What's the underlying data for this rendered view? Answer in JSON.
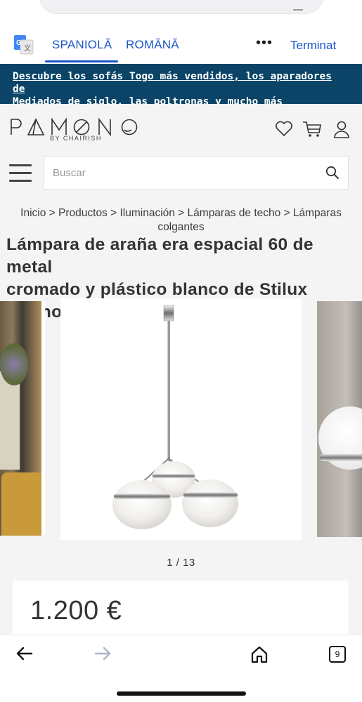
{
  "translate": {
    "source_lang": "SPANIOLĂ",
    "target_lang": "ROMÂNĂ",
    "more": "•••",
    "done": "Terminat"
  },
  "promo": {
    "line1": "Descubre los sofás Togo más vendidos, los aparadores de",
    "line2": "Mediados de siglo, las poltronas y mucho más"
  },
  "header": {
    "logo_text": "PAMONO",
    "logo_sub": "BY CHAIRISH"
  },
  "search": {
    "placeholder": "Buscar"
  },
  "breadcrumb": {
    "line1": "Inicio > Productos > Iluminación > Lámparas de techo > Lámparas",
    "line2": "colgantes"
  },
  "product": {
    "title_line1": "Lámpara de araña era espacial 60 de metal",
    "title_line2": "cromado y plástico blanco de Stilux Milano",
    "counter": "1 / 13",
    "price": "1.200 €"
  },
  "browser": {
    "tabs_count": "9"
  },
  "colors": {
    "accent_blue": "#1a56c9",
    "promo_bg": "#0b4467",
    "page_bg": "#f4f4f4"
  }
}
